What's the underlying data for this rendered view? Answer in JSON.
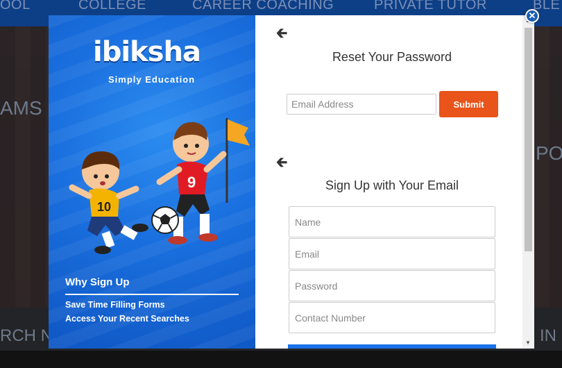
{
  "background": {
    "nav_items": [
      "OOL",
      "COLLEGE",
      "CAREER COACHING",
      "PRIVATE TUTOR",
      "BLE"
    ],
    "left_text": "AMS",
    "right_text": "POI",
    "bottom_left_text": "RCH N",
    "bottom_right_text": "IN"
  },
  "modal": {
    "brand": {
      "logo_text": "ibiksha",
      "tagline": "Simply Education"
    },
    "why_signup": {
      "title": "Why Sign Up",
      "items": [
        "Save Time Filling Forms",
        "Access Your Recent Searches"
      ]
    },
    "reset": {
      "back_icon": "arrow-left-icon",
      "title": "Reset Your Password",
      "email_placeholder": "Email Address",
      "submit_label": "Submit"
    },
    "signup": {
      "back_icon": "arrow-left-icon",
      "title": "Sign Up with Your Email",
      "name_placeholder": "Name",
      "email_placeholder": "Email",
      "password_placeholder": "Password",
      "contact_placeholder": "Contact Number"
    },
    "close_icon": "close-icon"
  },
  "colors": {
    "accent_orange": "#e8541a",
    "brand_blue": "#1a6fde",
    "nav_blue": "#0d3f86"
  }
}
